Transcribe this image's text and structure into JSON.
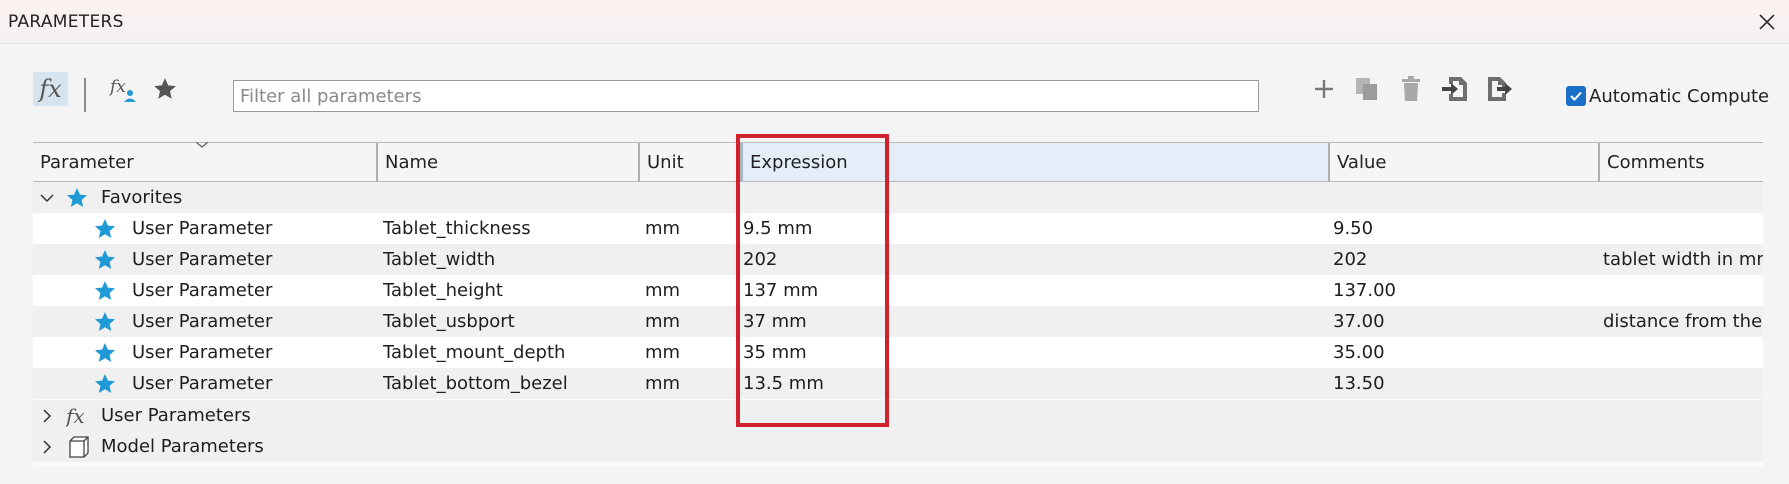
{
  "window": {
    "title": "PARAMETERS"
  },
  "toolbar": {
    "search_placeholder": "Filter all parameters",
    "automatic_compute_label": "Automatic Compute",
    "automatic_compute_checked": true
  },
  "columns": [
    {
      "label": "Parameter"
    },
    {
      "label": "Name"
    },
    {
      "label": "Unit"
    },
    {
      "label": "Expression"
    },
    {
      "label": "Value"
    },
    {
      "label": "Comments"
    }
  ],
  "groups": {
    "favorites": {
      "label": "Favorites",
      "expanded": true
    },
    "user_parameters": {
      "label": "User Parameters",
      "expanded": false
    },
    "model_parameters": {
      "label": "Model Parameters",
      "expanded": false
    }
  },
  "rows": [
    {
      "parameter": "User Parameter",
      "name": "Tablet_thickness",
      "unit": "mm",
      "expression": "9.5 mm",
      "value": "9.50",
      "comment": ""
    },
    {
      "parameter": "User Parameter",
      "name": "Tablet_width",
      "unit": "",
      "expression": "202",
      "value": "202",
      "comment": "tablet width in mm"
    },
    {
      "parameter": "User Parameter",
      "name": "Tablet_height",
      "unit": "mm",
      "expression": "137 mm",
      "value": "137.00",
      "comment": ""
    },
    {
      "parameter": "User Parameter",
      "name": "Tablet_usbport",
      "unit": "mm",
      "expression": "37 mm",
      "value": "37.00",
      "comment": "distance from the b"
    },
    {
      "parameter": "User Parameter",
      "name": "Tablet_mount_depth",
      "unit": "mm",
      "expression": "35 mm",
      "value": "35.00",
      "comment": ""
    },
    {
      "parameter": "User Parameter",
      "name": "Tablet_bottom_bezel",
      "unit": "mm",
      "expression": "13.5 mm",
      "value": "13.50",
      "comment": ""
    }
  ],
  "icons": {
    "fx": "fx-icon",
    "user_fx": "user-parameter-fx-icon",
    "star": "star-icon",
    "add": "plus-icon",
    "copy": "copy-icon",
    "delete": "trash-icon",
    "import": "import-icon",
    "export": "export-icon",
    "close": "close-icon",
    "cube": "cube-icon"
  },
  "colors": {
    "accent": "#1b6fc7",
    "star": "#1f9ad6",
    "highlight": "#d0212c",
    "selected_header": "#e3eef8"
  }
}
